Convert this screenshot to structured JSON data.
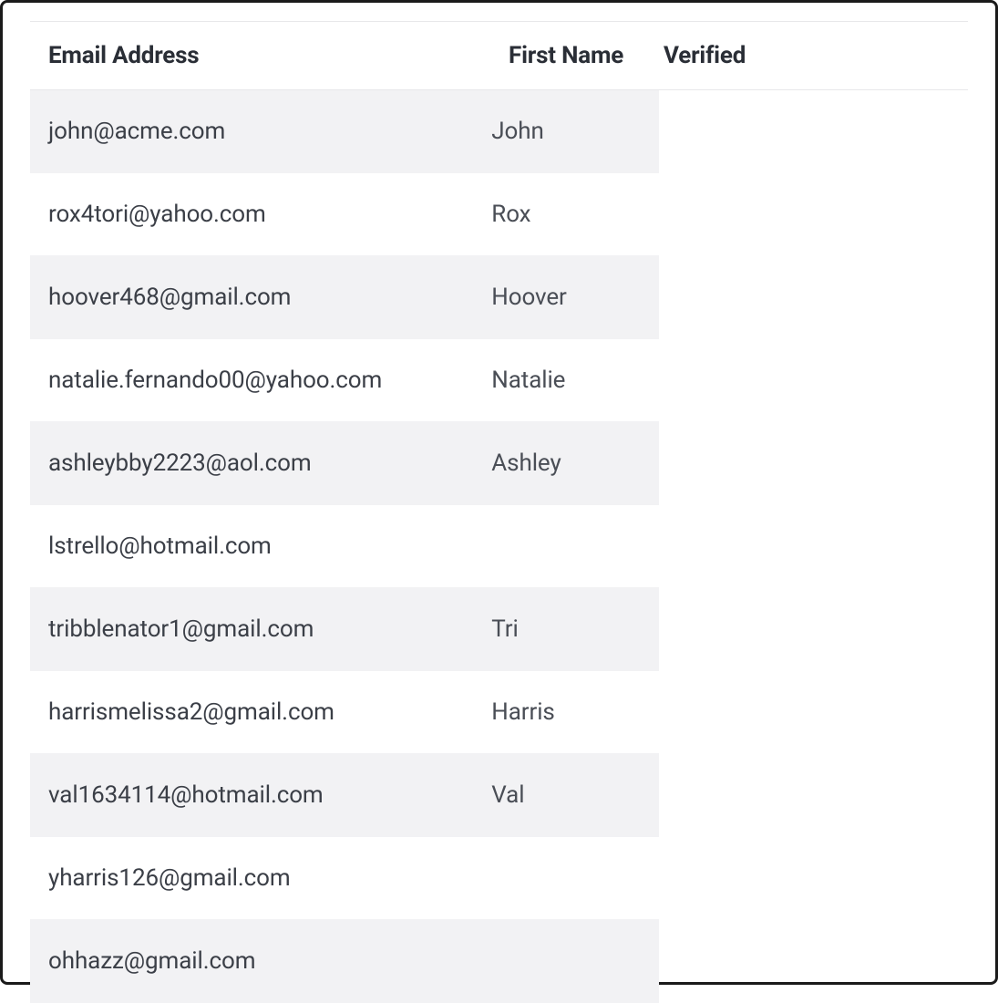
{
  "table": {
    "headers": {
      "email": "Email Address",
      "first_name": "First Name",
      "verified": "Verified"
    },
    "rows": [
      {
        "email": "john@acme.com",
        "first_name": "John"
      },
      {
        "email": "rox4tori@yahoo.com",
        "first_name": "Rox"
      },
      {
        "email": "hoover468@gmail.com",
        "first_name": "Hoover"
      },
      {
        "email": "natalie.fernando00@yahoo.com",
        "first_name": "Natalie"
      },
      {
        "email": "ashleybby2223@aol.com",
        "first_name": "Ashley"
      },
      {
        "email": "lstrello@hotmail.com",
        "first_name": ""
      },
      {
        "email": "tribblenator1@gmail.com",
        "first_name": "Tri"
      },
      {
        "email": "harrismelissa2@gmail.com",
        "first_name": "Harris"
      },
      {
        "email": "val1634114@hotmail.com",
        "first_name": "Val"
      },
      {
        "email": "yharris126@gmail.com",
        "first_name": ""
      },
      {
        "email": "ohhazz@gmail.com",
        "first_name": ""
      }
    ]
  }
}
